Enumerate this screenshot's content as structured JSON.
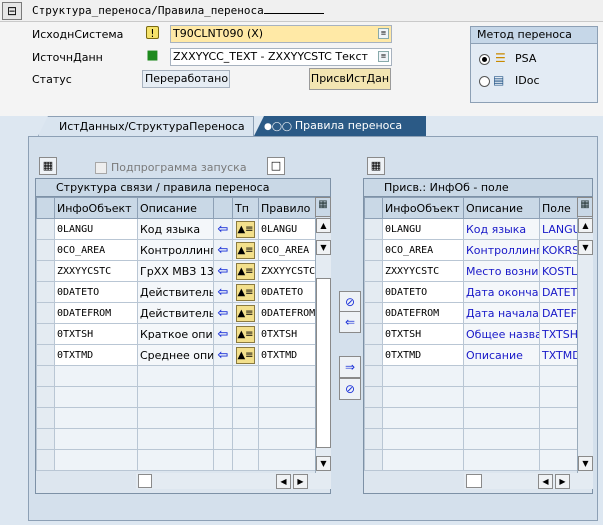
{
  "title": {
    "text": "Структура_переноса/Правила_переноса"
  },
  "header": {
    "source_system_label": "ИсходнСистема",
    "source_system_value": "T90CLNT090 (X)",
    "datasource_label": "ИсточнДанн",
    "datasource_value": "ZXXYYCC_TEXT - ZXXYYCSTC Текст",
    "status_label": "Статус",
    "status_value": "Переработано",
    "assign_button": "ПрисвИстДан"
  },
  "transfer_method": {
    "title": "Метод переноса",
    "options": [
      {
        "label": "PSA",
        "selected": true
      },
      {
        "label": "IDoc",
        "selected": false
      }
    ]
  },
  "tabs": [
    {
      "label": "ИстДанных/СтруктураПереноса",
      "active": false
    },
    {
      "label": "Правила переноса",
      "active": true
    }
  ],
  "left": {
    "checkbox_label": "Подпрограмма запуска",
    "title": "Структура связи / правила переноса",
    "columns": [
      "ИнфоОбъект",
      "Описание",
      "",
      "Тп",
      "Правило"
    ],
    "rows": [
      {
        "obj": "0LANGU",
        "desc": "Код языка",
        "rule": "0LANGU"
      },
      {
        "obj": "0CO_AREA",
        "desc": "Контроллинг",
        "rule": "0CO_AREA"
      },
      {
        "obj": "ZXXYYCSTC",
        "desc": "ГрХХ МВЗ 13",
        "rule": "ZXXYYCSTC"
      },
      {
        "obj": "0DATETO",
        "desc": "Действителы",
        "rule": "0DATETO"
      },
      {
        "obj": "0DATEFROM",
        "desc": "Действителы",
        "rule": "0DATEFROM"
      },
      {
        "obj": "0TXTSH",
        "desc": "Краткое описа",
        "rule": "0TXTSH"
      },
      {
        "obj": "0TXTMD",
        "desc": "Среднее описа",
        "rule": "0TXTMD"
      }
    ],
    "empty_rows": 5
  },
  "right": {
    "title": "Присв.: ИнфОб - поле",
    "columns": [
      "ИнфоОбъект",
      "Описание",
      "Поле"
    ],
    "rows": [
      {
        "obj": "0LANGU",
        "desc": "Код языка",
        "field": "LANGU"
      },
      {
        "obj": "0CO_AREA",
        "desc": "Контроллинг",
        "field": "KOKRS"
      },
      {
        "obj": "ZXXYYCSTC",
        "desc": "Место возник",
        "field": "KOSTL"
      },
      {
        "obj": "0DATETO",
        "desc": "Дата окончан",
        "field": "DATETO"
      },
      {
        "obj": "0DATEFROM",
        "desc": "Дата начала",
        "field": "DATEFROM"
      },
      {
        "obj": "0TXTSH",
        "desc": "Общее назва",
        "field": "TXTSH"
      },
      {
        "obj": "0TXTMD",
        "desc": "Описание",
        "field": "TXTMD"
      }
    ],
    "empty_rows": 5
  },
  "icons": {
    "tb": "title-icon",
    "src_status": "green-light-icon",
    "transfer": "transfer-rule-icon",
    "arrow": "arrow-left-icon"
  },
  "colors": {
    "active_tab": "#2b5a86",
    "blue_text": "#1818c8",
    "input_yellow": "#ffe9a6"
  }
}
